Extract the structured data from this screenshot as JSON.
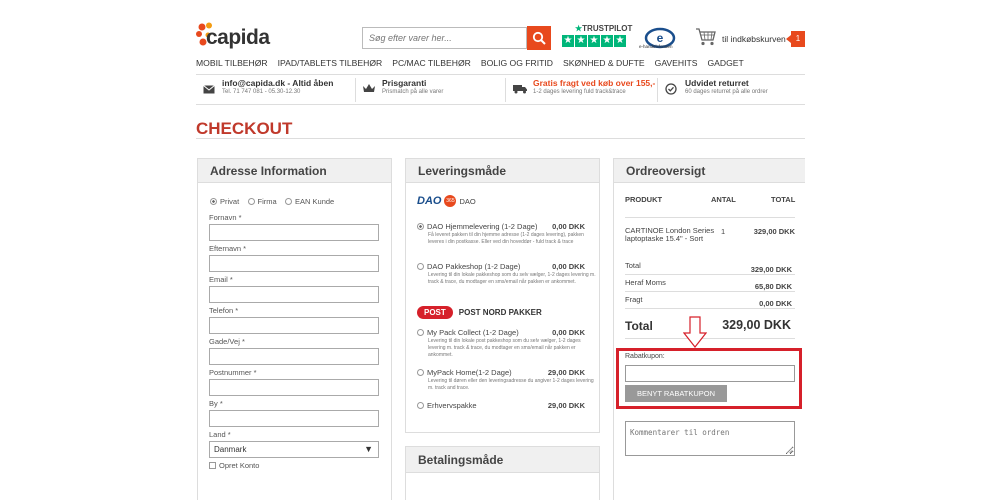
{
  "header": {
    "logo": "capida",
    "search_placeholder": "Søg efter varer her...",
    "trustpilot_label": "TRUSTPILOT",
    "emaerket_text": "e-handelsfonden",
    "cart_label": "til indkøbskurven",
    "cart_count": "1"
  },
  "nav": [
    "MOBIL TILBEHØR",
    "IPAD/TABLETS TILBEHØR",
    "PC/MAC TILBEHØR",
    "BOLIG OG FRITID",
    "SKØNHED & DUFTE",
    "GAVEHITS",
    "GADGET"
  ],
  "info": [
    {
      "title": "info@capida.dk - Altid åben",
      "sub": "Tel. 71 747 081 - 05.30-12.30",
      "icon": "envelope-icon"
    },
    {
      "title": "Prisgaranti",
      "sub": "Prismatch på alle varer",
      "icon": "crown-icon"
    },
    {
      "title": "Gratis fragt ved køb over 155,-",
      "sub": "1-2 dages levering fuld track&trace",
      "icon": "truck-icon"
    },
    {
      "title": "Udvidet returret",
      "sub": "60 dages returret på alle ordrer",
      "icon": "check-circle-icon"
    }
  ],
  "checkout_title": "CHECKOUT",
  "address": {
    "title": "Adresse Information",
    "types": [
      "Privat",
      "Firma",
      "EAN Kunde"
    ],
    "fields": [
      "Fornavn *",
      "Efternavn *",
      "Email *",
      "Telefon *",
      "Gade/Vej *",
      "Postnummer *",
      "By *"
    ],
    "country_label": "Land *",
    "country_value": "Danmark",
    "create_account": "Opret Konto"
  },
  "delivery": {
    "title": "Leveringsmåde",
    "dao_logo": "DAO",
    "dao_badge": "365",
    "dao_label": "DAO",
    "post_logo": "POST",
    "post_label": "POST NORD PAKKER",
    "options": [
      {
        "name": "DAO Hjemmelevering (1-2 Dage)",
        "price": "0,00 DKK",
        "desc": "Få leveret pakken til din hjemme adresse (1-2 dages levering), pakken leveres i din postkasse. Eller ved din hoveddør - fuld track & trace"
      },
      {
        "name": "DAO Pakkeshop (1-2 Dage)",
        "price": "0,00 DKK",
        "desc": "Levering til din lokale pakkeshop som du selv vælger, 1-2 dages levering m. track & trace, du modtager en sms/email når pakken er ankommet."
      },
      {
        "name": "My Pack Collect (1-2 Dage)",
        "price": "0,00 DKK",
        "desc": "Levering til din lokale post pakkeshop som du selv vælger, 1-2 dages levering m. track & trace, du modtager en sms/email når pakken er ankommet."
      },
      {
        "name": "MyPack Home(1-2 Dage)",
        "price": "29,00 DKK",
        "desc": "Levering til døren eller den leveringsadresse du angiver 1-2 dages levering m. track and trace."
      },
      {
        "name": "Erhvervspakke",
        "price": "29,00 DKK",
        "desc": ""
      }
    ]
  },
  "payment": {
    "title": "Betalingsmåde"
  },
  "order": {
    "title": "Ordreoversigt",
    "col_product": "PRODUKT",
    "col_qty": "ANTAL",
    "col_total": "TOTAL",
    "product_name": "CARTINOE London Series laptoptaske 15.4\" - Sort",
    "product_qty": "1",
    "product_total": "329,00 DKK",
    "total_label": "Total",
    "total_value": "329,00 DKK",
    "vat_label": "Heraf Moms",
    "vat_value": "65,80 DKK",
    "shipping_label": "Fragt",
    "shipping_value": "0,00 DKK",
    "grand_label": "Total",
    "grand_value": "329,00 DKK",
    "coupon_label": "Rabatkupon:",
    "coupon_button": "BENYT RABATKUPON",
    "comment_placeholder": "Kommentarer til ordren"
  },
  "colors": {
    "accent": "#e8491d",
    "checkout": "#c0392b",
    "highlight": "#d6202a",
    "trustpilot": "#00b67a"
  }
}
